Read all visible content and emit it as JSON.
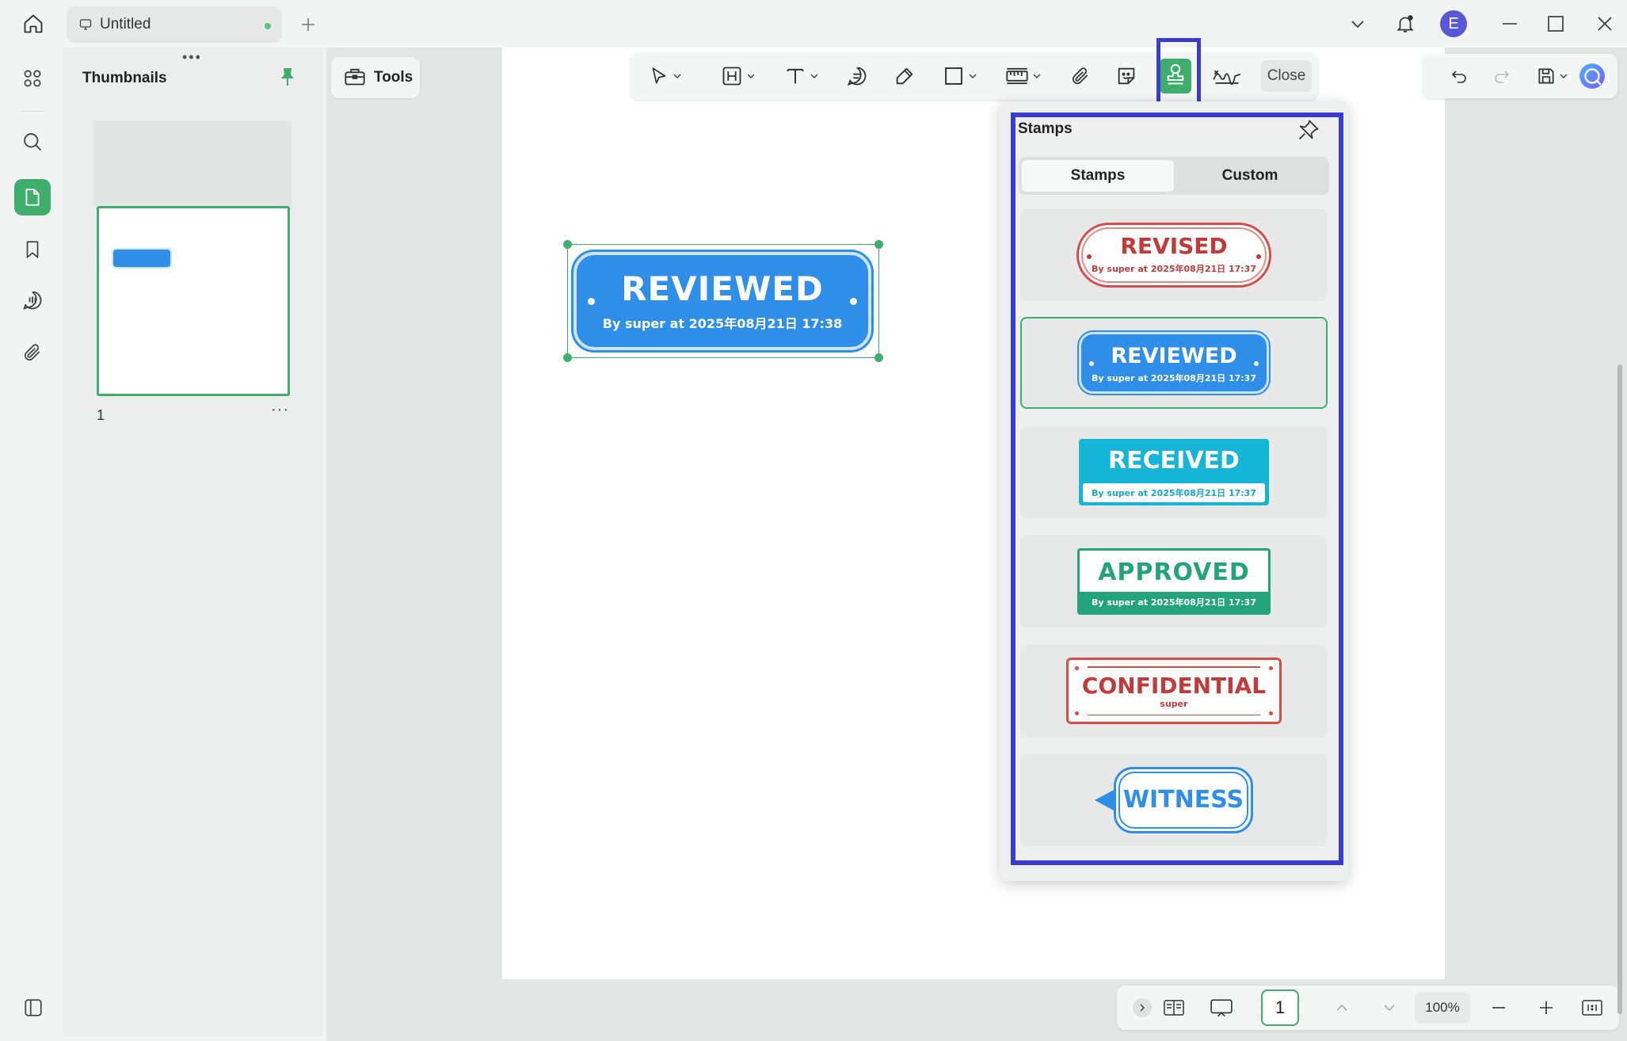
{
  "app": {
    "tab_title": "Untitled",
    "avatar_letter": "E"
  },
  "thumbnails": {
    "title": "Thumbnails",
    "grip": "•••",
    "pages": [
      {
        "number": "1",
        "more": "···"
      }
    ]
  },
  "toolbar": {
    "tools_label": "Tools",
    "close_label": "Close",
    "active_tool": "stamp"
  },
  "placed_stamp": {
    "title": "REVIEWED",
    "subtitle": "By super at 2025年08月21日 17:38",
    "color": "#2f8fe8"
  },
  "stamps_panel": {
    "title": "Stamps",
    "tabs": [
      {
        "label": "Stamps",
        "active": true
      },
      {
        "label": "Custom",
        "active": false
      }
    ],
    "items": [
      {
        "name": "REVISED",
        "subtitle": "By super at 2025年08月21日 17:37",
        "color": "#c33a3a",
        "selected": false
      },
      {
        "name": "REVIEWED",
        "subtitle": "By super at 2025年08月21日 17:37",
        "color": "#2f8fe8",
        "selected": true
      },
      {
        "name": "RECEIVED",
        "subtitle": "By super at 2025年08月21日 17:37",
        "color": "#14b5d6",
        "selected": false
      },
      {
        "name": "APPROVED",
        "subtitle": "By super at 2025年08月21日 17:37",
        "color": "#22a37a",
        "selected": false
      },
      {
        "name": "CONFIDENTIAL",
        "subtitle": "super",
        "color": "#c33a3a",
        "selected": false
      },
      {
        "name": "WITNESS",
        "subtitle": "",
        "color": "#2f8fe8",
        "selected": false
      }
    ]
  },
  "bottom_bar": {
    "page_number": "1",
    "zoom": "100%"
  },
  "colors": {
    "accent": "#3fae6d",
    "highlight": "#3b3bd0"
  }
}
